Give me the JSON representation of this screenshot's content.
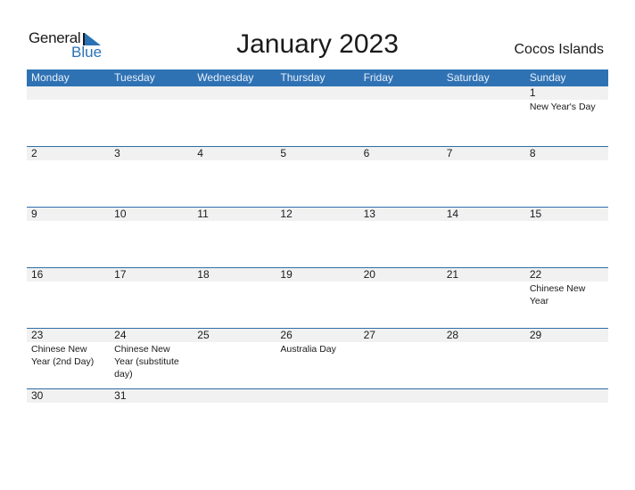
{
  "logo": {
    "text1": "General",
    "text2": "Blue"
  },
  "title": "January 2023",
  "country": "Cocos Islands",
  "colors": {
    "header_bg": "#2f72b4",
    "accent": "#2a72b5",
    "band": "#f1f1f1"
  },
  "weekdays": [
    "Monday",
    "Tuesday",
    "Wednesday",
    "Thursday",
    "Friday",
    "Saturday",
    "Sunday"
  ],
  "weeks": [
    {
      "days": [
        {
          "n": "",
          "ev": ""
        },
        {
          "n": "",
          "ev": ""
        },
        {
          "n": "",
          "ev": ""
        },
        {
          "n": "",
          "ev": ""
        },
        {
          "n": "",
          "ev": ""
        },
        {
          "n": "",
          "ev": ""
        },
        {
          "n": "1",
          "ev": "New Year's Day"
        }
      ]
    },
    {
      "days": [
        {
          "n": "2",
          "ev": ""
        },
        {
          "n": "3",
          "ev": ""
        },
        {
          "n": "4",
          "ev": ""
        },
        {
          "n": "5",
          "ev": ""
        },
        {
          "n": "6",
          "ev": ""
        },
        {
          "n": "7",
          "ev": ""
        },
        {
          "n": "8",
          "ev": ""
        }
      ]
    },
    {
      "days": [
        {
          "n": "9",
          "ev": ""
        },
        {
          "n": "10",
          "ev": ""
        },
        {
          "n": "11",
          "ev": ""
        },
        {
          "n": "12",
          "ev": ""
        },
        {
          "n": "13",
          "ev": ""
        },
        {
          "n": "14",
          "ev": ""
        },
        {
          "n": "15",
          "ev": ""
        }
      ]
    },
    {
      "days": [
        {
          "n": "16",
          "ev": ""
        },
        {
          "n": "17",
          "ev": ""
        },
        {
          "n": "18",
          "ev": ""
        },
        {
          "n": "19",
          "ev": ""
        },
        {
          "n": "20",
          "ev": ""
        },
        {
          "n": "21",
          "ev": ""
        },
        {
          "n": "22",
          "ev": "Chinese New Year"
        }
      ]
    },
    {
      "days": [
        {
          "n": "23",
          "ev": "Chinese New Year (2nd Day)"
        },
        {
          "n": "24",
          "ev": "Chinese New Year (substitute day)"
        },
        {
          "n": "25",
          "ev": ""
        },
        {
          "n": "26",
          "ev": "Australia Day"
        },
        {
          "n": "27",
          "ev": ""
        },
        {
          "n": "28",
          "ev": ""
        },
        {
          "n": "29",
          "ev": ""
        }
      ]
    },
    {
      "days": [
        {
          "n": "30",
          "ev": ""
        },
        {
          "n": "31",
          "ev": ""
        },
        {
          "n": "",
          "ev": ""
        },
        {
          "n": "",
          "ev": ""
        },
        {
          "n": "",
          "ev": ""
        },
        {
          "n": "",
          "ev": ""
        },
        {
          "n": "",
          "ev": ""
        }
      ]
    }
  ]
}
